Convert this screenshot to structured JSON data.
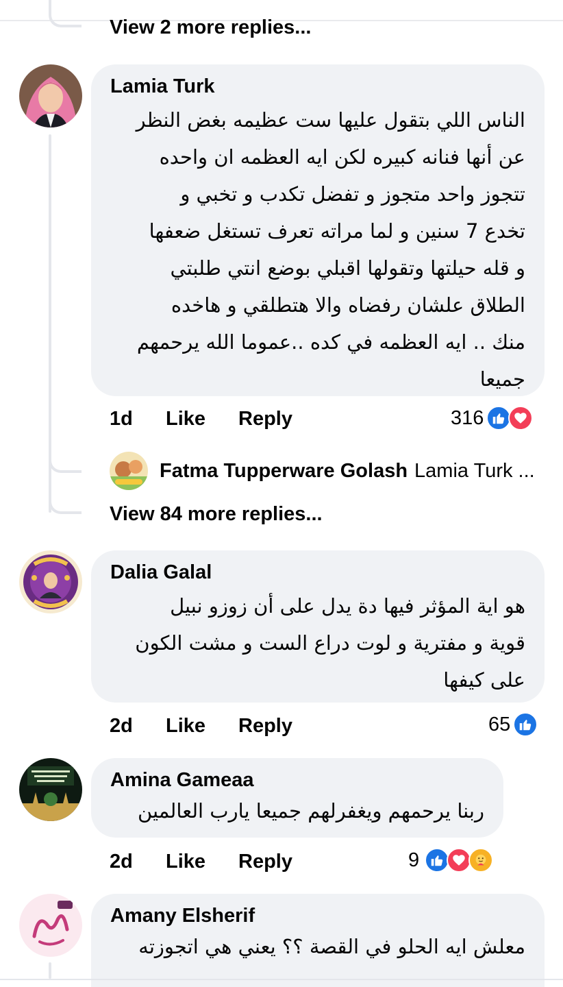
{
  "top": {
    "view_more": "View 2 more replies..."
  },
  "comments": [
    {
      "author": "Lamia Turk",
      "text": "الناس اللي بتقول عليها ست عظيمه بغض النظر\nعن أنها فنانه كبيره لكن ايه العظمه ان واحده\nتتجوز واحد متجوز و تفضل تكدب و تخبي و\nتخدع 7 سنين و لما مراته تعرف تستغل ضعفها\nو قله حيلتها وتقولها اقبلي بوضع انتي طلبتي\nالطلاق علشان رفضاه والا هتطلقي و هاخده\nمنك .. ايه العظمه في كده ..عموما الله يرحمهم\nجميعا",
      "time": "1d",
      "like_label": "Like",
      "reply_label": "Reply",
      "reaction_count": "316",
      "reactions": [
        "like-icon",
        "love-icon"
      ],
      "reply_preview": {
        "name": "Fatma Tupperware Golash",
        "text": "Lamia Turk ..."
      },
      "view_more": "View 84 more replies..."
    },
    {
      "author": "Dalia Galal",
      "text": "هو اية المؤثر فيها دة يدل على أن زوزو نبيل\nقوية و مفترية و لوت دراع الست و مشت الكون\nعلى كيفها",
      "time": "2d",
      "like_label": "Like",
      "reply_label": "Reply",
      "reaction_count": "65",
      "reactions": [
        "like-icon"
      ]
    },
    {
      "author": "Amina Gameaa",
      "text": "ربنا يرحمهم ويغفرلهم جميعا يارب العالمين",
      "time": "2d",
      "like_label": "Like",
      "reply_label": "Reply",
      "reaction_count": "9",
      "reactions": [
        "like-icon",
        "love-icon",
        "care-icon"
      ]
    },
    {
      "author": "Amany Elsherif",
      "text": "معلش ايه الحلو في القصة ؟؟ يعني هي اتجوزته"
    }
  ],
  "colors": {
    "like_blue": "#1b74e4",
    "love_red": "#f33e58",
    "care_yellow": "#f7b125",
    "bubble_bg": "#f0f2f5"
  }
}
